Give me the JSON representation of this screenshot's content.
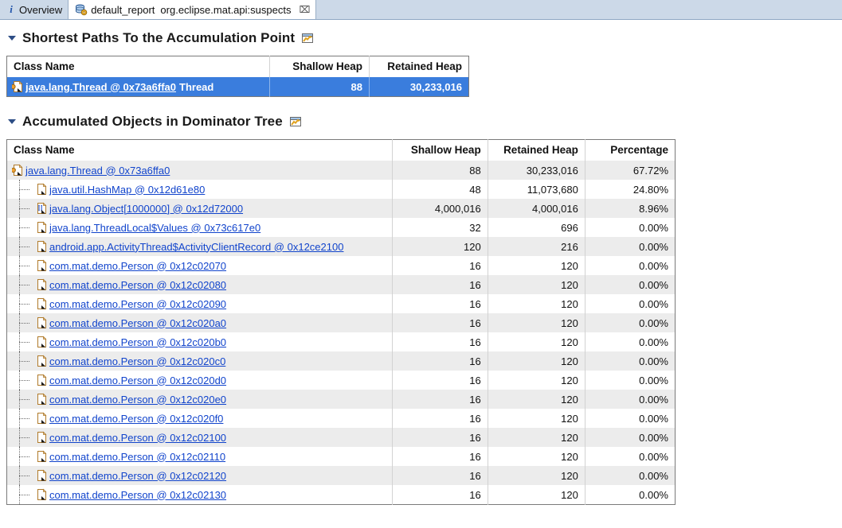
{
  "window": {
    "tabs": [
      {
        "id": "overview",
        "label": "Overview",
        "sublabel": "",
        "icon": "info-icon",
        "active": false,
        "closable": false
      },
      {
        "id": "default_report",
        "label": "default_report",
        "sublabel": "org.eclipse.mat.api:suspects",
        "icon": "report-database-icon",
        "active": true,
        "closable": true,
        "close_glyph": "⌧"
      }
    ]
  },
  "sections": [
    {
      "id": "shortest-paths",
      "title": "Shortest Paths To the Accumulation Point",
      "expanded": true,
      "action_icon": "open-in-pane-icon"
    },
    {
      "id": "accumulated-objects",
      "title": "Accumulated Objects in Dominator Tree",
      "expanded": true,
      "action_icon": "open-in-pane-icon"
    }
  ],
  "paths_table": {
    "columns": [
      "Class Name",
      "Shallow Heap",
      "Retained Heap"
    ],
    "rows": [
      {
        "name": "java.lang.Thread @ 0x73a6ffa0",
        "suffix": "Thread",
        "shallow": "88",
        "retained": "30,233,016",
        "selected": true,
        "icon": "thread-object-icon"
      }
    ]
  },
  "dominator_table": {
    "columns": [
      "Class Name",
      "Shallow Heap",
      "Retained Heap",
      "Percentage"
    ],
    "rows": [
      {
        "name": "java.lang.Thread @ 0x73a6ffa0",
        "shallow": "88",
        "retained": "30,233,016",
        "percentage": "67.72%",
        "level": 0,
        "icon": "thread-object-icon"
      },
      {
        "name": "java.util.HashMap @ 0x12d61e80",
        "shallow": "48",
        "retained": "11,073,680",
        "percentage": "24.80%",
        "level": 1,
        "icon": "object-icon"
      },
      {
        "name": "java.lang.Object[1000000] @ 0x12d72000",
        "shallow": "4,000,016",
        "retained": "4,000,016",
        "percentage": "8.96%",
        "level": 1,
        "icon": "array-object-icon"
      },
      {
        "name": "java.lang.ThreadLocal$Values @ 0x73c617e0",
        "shallow": "32",
        "retained": "696",
        "percentage": "0.00%",
        "level": 1,
        "icon": "object-icon"
      },
      {
        "name": "android.app.ActivityThread$ActivityClientRecord @ 0x12ce2100",
        "shallow": "120",
        "retained": "216",
        "percentage": "0.00%",
        "level": 1,
        "icon": "object-icon"
      },
      {
        "name": "com.mat.demo.Person @ 0x12c02070",
        "shallow": "16",
        "retained": "120",
        "percentage": "0.00%",
        "level": 1,
        "icon": "object-icon"
      },
      {
        "name": "com.mat.demo.Person @ 0x12c02080",
        "shallow": "16",
        "retained": "120",
        "percentage": "0.00%",
        "level": 1,
        "icon": "object-icon"
      },
      {
        "name": "com.mat.demo.Person @ 0x12c02090",
        "shallow": "16",
        "retained": "120",
        "percentage": "0.00%",
        "level": 1,
        "icon": "object-icon"
      },
      {
        "name": "com.mat.demo.Person @ 0x12c020a0",
        "shallow": "16",
        "retained": "120",
        "percentage": "0.00%",
        "level": 1,
        "icon": "object-icon"
      },
      {
        "name": "com.mat.demo.Person @ 0x12c020b0",
        "shallow": "16",
        "retained": "120",
        "percentage": "0.00%",
        "level": 1,
        "icon": "object-icon"
      },
      {
        "name": "com.mat.demo.Person @ 0x12c020c0",
        "shallow": "16",
        "retained": "120",
        "percentage": "0.00%",
        "level": 1,
        "icon": "object-icon"
      },
      {
        "name": "com.mat.demo.Person @ 0x12c020d0",
        "shallow": "16",
        "retained": "120",
        "percentage": "0.00%",
        "level": 1,
        "icon": "object-icon"
      },
      {
        "name": "com.mat.demo.Person @ 0x12c020e0",
        "shallow": "16",
        "retained": "120",
        "percentage": "0.00%",
        "level": 1,
        "icon": "object-icon"
      },
      {
        "name": "com.mat.demo.Person @ 0x12c020f0",
        "shallow": "16",
        "retained": "120",
        "percentage": "0.00%",
        "level": 1,
        "icon": "object-icon"
      },
      {
        "name": "com.mat.demo.Person @ 0x12c02100",
        "shallow": "16",
        "retained": "120",
        "percentage": "0.00%",
        "level": 1,
        "icon": "object-icon"
      },
      {
        "name": "com.mat.demo.Person @ 0x12c02110",
        "shallow": "16",
        "retained": "120",
        "percentage": "0.00%",
        "level": 1,
        "icon": "object-icon"
      },
      {
        "name": "com.mat.demo.Person @ 0x12c02120",
        "shallow": "16",
        "retained": "120",
        "percentage": "0.00%",
        "level": 1,
        "icon": "object-icon"
      },
      {
        "name": "com.mat.demo.Person @ 0x12c02130",
        "shallow": "16",
        "retained": "120",
        "percentage": "0.00%",
        "level": 1,
        "icon": "object-icon"
      }
    ]
  },
  "colors": {
    "selection_blue": "#3a7ddd",
    "link_blue": "#1144cc",
    "tabbar_bg": "#ccd9e8",
    "row_stripe": "#ececec"
  }
}
